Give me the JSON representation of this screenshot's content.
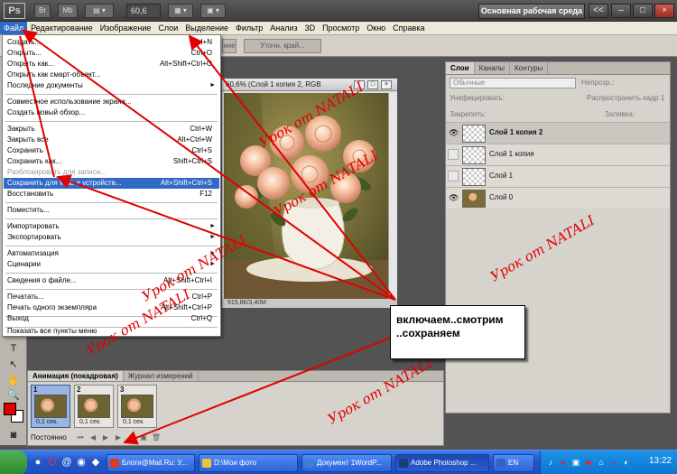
{
  "app": {
    "logo": "Ps",
    "buttons": [
      "Br",
      "Mb"
    ],
    "zoom": "60,6",
    "workspace": "Основная рабочая среда",
    "window_controls": [
      "<<",
      "–",
      "□",
      "×"
    ]
  },
  "menubar": [
    "Файл",
    "Редактирование",
    "Изображение",
    "Слои",
    "Выделение",
    "Фильтр",
    "Анализ",
    "3D",
    "Просмотр",
    "Окно",
    "Справка"
  ],
  "options": {
    "refine_button": "Уточн. край...",
    "partial_label": "ние"
  },
  "file_menu": {
    "items": [
      {
        "label": "Создать...",
        "shortcut": "Ctrl+N"
      },
      {
        "label": "Открыть...",
        "shortcut": "Ctrl+O"
      },
      {
        "label": "Открыть как...",
        "shortcut": "Alt+Shift+Ctrl+O"
      },
      {
        "label": "Открыть как смарт-объект...",
        "shortcut": ""
      },
      {
        "label": "Последние документы",
        "shortcut": "",
        "arrow": "►"
      },
      {
        "label": "Совместное использование экрана...",
        "shortcut": ""
      },
      {
        "label": "Создать новый обзор...",
        "shortcut": ""
      },
      {
        "label": "Закрыть",
        "shortcut": "Ctrl+W"
      },
      {
        "label": "Закрыть все",
        "shortcut": "Alt+Ctrl+W"
      },
      {
        "label": "Сохранить",
        "shortcut": "Ctrl+S"
      },
      {
        "label": "Сохранить как...",
        "shortcut": "Shift+Ctrl+S"
      },
      {
        "label": "Разблокировать для записи...",
        "shortcut": ""
      },
      {
        "label": "Сохранить для Web и устройств...",
        "shortcut": "Alt+Shift+Ctrl+S"
      },
      {
        "label": "Восстановить",
        "shortcut": "F12"
      },
      {
        "label": "Поместить...",
        "shortcut": ""
      },
      {
        "label": "Импортировать",
        "shortcut": "",
        "arrow": "►"
      },
      {
        "label": "Экспортировать",
        "shortcut": "",
        "arrow": "►"
      },
      {
        "label": "Автоматизация",
        "shortcut": "",
        "arrow": "►"
      },
      {
        "label": "Сценарии",
        "shortcut": "",
        "arrow": "►"
      },
      {
        "label": "Сведения о файле...",
        "shortcut": "Alt+Shift+Ctrl+I"
      },
      {
        "label": "Печатать...",
        "shortcut": "Ctrl+P"
      },
      {
        "label": "Печать одного экземпляра",
        "shortcut": "Alt+Shift+Ctrl+P"
      },
      {
        "label": "Выход",
        "shortcut": "Ctrl+Q"
      },
      {
        "label": "Показать все пункты меню",
        "shortcut": ""
      }
    ]
  },
  "document": {
    "title": "60,6% (Слой 1 копия 2, RGB",
    "status": "915,8К/3,40М",
    "controls": [
      "_",
      "□",
      "×"
    ]
  },
  "layers_panel": {
    "tabs": [
      "Слои",
      "Каналы",
      "Контуры"
    ],
    "blend_mode": "Обычные",
    "opacity_label": "Непрозр.:",
    "unify_label": "Унифицировать:",
    "propagate_label": "Распространить кадр 1",
    "lock_label": "Закрепить:",
    "fill_label": "Заливка:",
    "layers": [
      {
        "name": "Слой 1 копия 2",
        "visible": true,
        "selected": true,
        "thumb": "checker"
      },
      {
        "name": "Слой 1 копия",
        "visible": false,
        "selected": false,
        "thumb": "checker"
      },
      {
        "name": "Слой 1",
        "visible": false,
        "selected": false,
        "thumb": "checker"
      },
      {
        "name": "Слой 0",
        "visible": true,
        "selected": false,
        "thumb": "photo"
      }
    ]
  },
  "animation_panel": {
    "tabs": [
      "Анимация (покадровая)",
      "Журнал измерений"
    ],
    "frames": [
      {
        "num": "1",
        "delay": "0,1 сек.",
        "selected": true
      },
      {
        "num": "2",
        "delay": "0,1 сек.",
        "selected": false
      },
      {
        "num": "3",
        "delay": "0,1 сек.",
        "selected": false
      }
    ],
    "loop": "Постоянно"
  },
  "annotations": {
    "callout": [
      "включаем..смотрим",
      "..сохраняем"
    ],
    "watermarks": [
      "Урок от NATALI",
      "Урок от NATALI",
      "Урок от NATALI",
      "Урок от NATALI",
      "Урок от NATALI",
      "Урок от NATALI"
    ],
    "arrow_color": "#e00000"
  },
  "taskbar": {
    "buttons": [
      {
        "label": "Блоги@Mail.Ru: У...",
        "icon_color": "#e03a1e"
      },
      {
        "label": "D:\\Мои фото",
        "icon_color": "#f0c040"
      },
      {
        "label": "Документ 1WordP...",
        "icon_color": "#3a7fd8"
      },
      {
        "label": "Adobe Photoshop ...",
        "icon_color": "#1d3c78",
        "active": true
      },
      {
        "label": "EN",
        "icon_color": "#2f63c8"
      }
    ],
    "clock": "13:22"
  }
}
